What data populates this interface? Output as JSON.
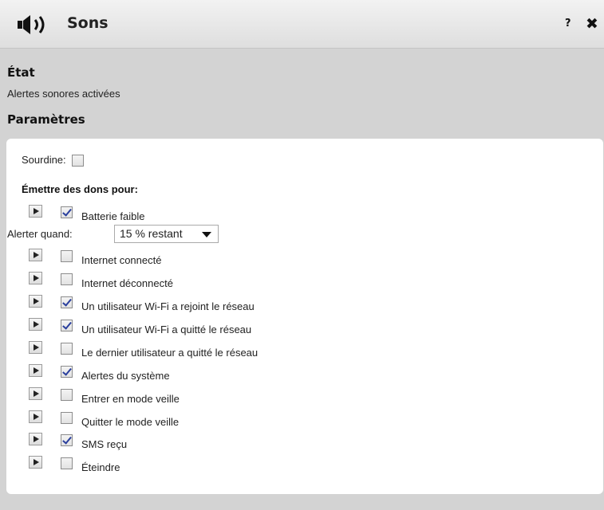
{
  "window": {
    "title": "Sons",
    "help_label": "?",
    "close_label": "✖"
  },
  "status": {
    "heading": "État",
    "text": "Alertes sonores activées"
  },
  "settings": {
    "heading": "Paramètres",
    "mute_label": "Sourdine:",
    "mute_checked": false,
    "emit_title": "Émettre des dons pour:",
    "alert_when_label": "Alerter quand:",
    "alert_when_value": "15 % restant",
    "items": [
      {
        "label": "Batterie faible",
        "checked": true
      },
      {
        "label": "Internet connecté",
        "checked": false
      },
      {
        "label": "Internet déconnecté",
        "checked": false
      },
      {
        "label": "Un utilisateur Wi-Fi a rejoint le réseau",
        "checked": true
      },
      {
        "label": "Un utilisateur Wi-Fi a quitté le réseau",
        "checked": true
      },
      {
        "label": "Le dernier utilisateur a quitté le réseau",
        "checked": false
      },
      {
        "label": "Alertes du système",
        "checked": true
      },
      {
        "label": "Entrer en mode veille",
        "checked": false
      },
      {
        "label": "Quitter le mode veille",
        "checked": false
      },
      {
        "label": "SMS reçu",
        "checked": true
      },
      {
        "label": "Éteindre",
        "checked": false
      }
    ]
  },
  "icons": {
    "title_icon": "speaker-volume-icon",
    "sound_preview": "play-icon"
  }
}
